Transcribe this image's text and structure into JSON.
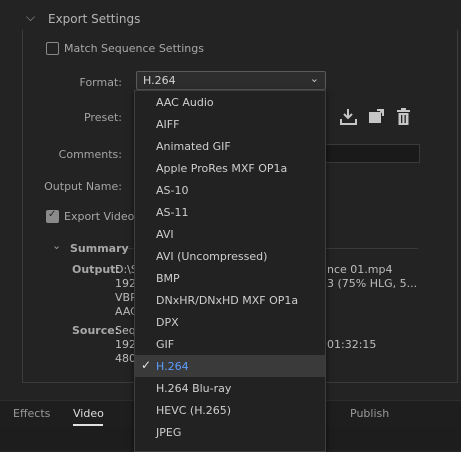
{
  "header": {
    "title": "Export Settings"
  },
  "match_sequence": {
    "label": "Match Sequence Settings",
    "checked": false
  },
  "format": {
    "label": "Format:",
    "value": "H.264"
  },
  "preset": {
    "label": "Preset:"
  },
  "comments": {
    "label": "Comments:"
  },
  "output_name": {
    "label": "Output Name:"
  },
  "export_video": {
    "label": "Export Video",
    "checked": true
  },
  "summary": {
    "title": "Summary",
    "output_label": "Output:",
    "output_lines": [
      "D:\\S",
      "192",
      "VBR",
      "AAC"
    ],
    "output_right_lines": [
      "nce 01.mp4",
      "3 (75% HLG, 5..."
    ],
    "source_label": "Source:",
    "source_lines": [
      "Seq",
      "192",
      "480"
    ],
    "source_right": "01:32:15"
  },
  "dropdown": {
    "items": [
      "AAC Audio",
      "AIFF",
      "Animated GIF",
      "Apple ProRes MXF OP1a",
      "AS-10",
      "AS-11",
      "AVI",
      "AVI (Uncompressed)",
      "BMP",
      "DNxHR/DNxHD MXF OP1a",
      "DPX",
      "GIF",
      "H.264",
      "H.264 Blu-ray",
      "HEVC (H.265)",
      "JPEG"
    ],
    "selected": "H.264"
  },
  "tabs": {
    "effects": "Effects",
    "video": "Video",
    "publish": "Publish"
  },
  "icons": {
    "collapse": "chevron-down-icon",
    "import_preset": "import-preset-icon",
    "save_preset": "save-preset-icon",
    "delete_preset": "trash-icon"
  }
}
